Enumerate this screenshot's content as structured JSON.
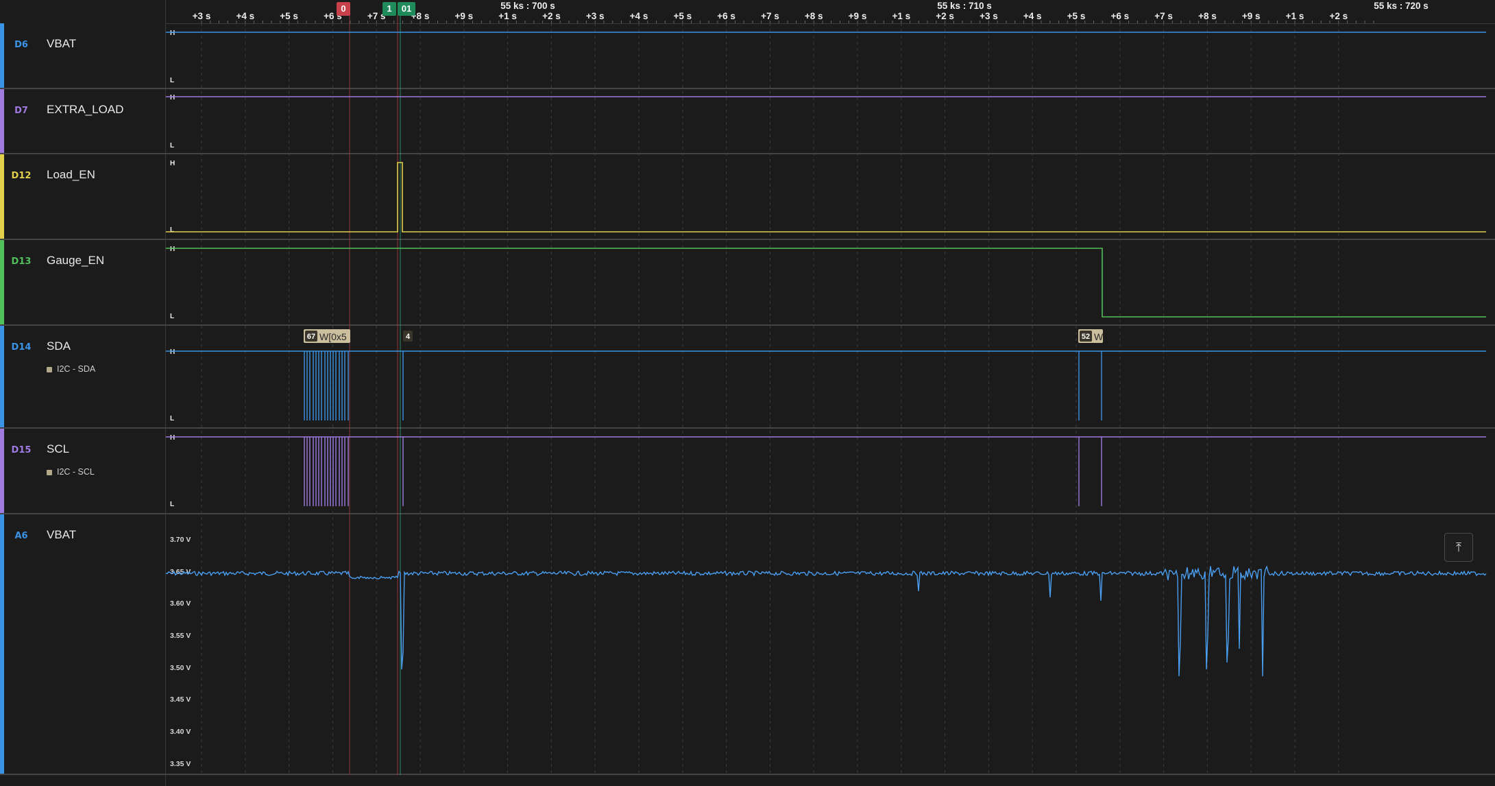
{
  "timeline": {
    "major_labels": [
      {
        "text": "55 ks : 700 s"
      },
      {
        "text": "55 ks : 710 s"
      },
      {
        "text": "55 ks : 720 s"
      }
    ],
    "ticks": [
      "+3 s",
      "+4 s",
      "+5 s",
      "+6 s",
      "+7 s",
      "+8 s",
      "+9 s",
      "+1 s",
      "+2 s",
      "+3 s",
      "+4 s",
      "+5 s",
      "+6 s",
      "+7 s",
      "+8 s",
      "+9 s",
      "+1 s",
      "+2 s",
      "+3 s",
      "+4 s",
      "+5 s",
      "+6 s",
      "+7 s",
      "+8 s",
      "+9 s",
      "+1 s",
      "+2 s"
    ],
    "markers": [
      {
        "label": "0",
        "color": "#c8404a"
      },
      {
        "label": "1",
        "color": "#1f8a5a"
      },
      {
        "label": "01",
        "color": "#1f8a5a"
      }
    ]
  },
  "channels": [
    {
      "id": "D6",
      "name": "VBAT",
      "color": "#3b93e6"
    },
    {
      "id": "D7",
      "name": "EXTRA_LOAD",
      "color": "#9f7be0"
    },
    {
      "id": "D12",
      "name": "Load_EN",
      "color": "#e2d04c"
    },
    {
      "id": "D13",
      "name": "Gauge_EN",
      "color": "#52c05a"
    },
    {
      "id": "D14",
      "name": "SDA",
      "color": "#3b93e6",
      "analyzer": "I2C - SDA"
    },
    {
      "id": "D15",
      "name": "SCL",
      "color": "#9f7be0",
      "analyzer": "I2C - SCL"
    },
    {
      "id": "A6",
      "name": "VBAT",
      "color": "#3b93e6"
    }
  ],
  "levels": {
    "high": "H",
    "low": "L"
  },
  "i2c_decodes": [
    {
      "badge": "67",
      "text": "W[0x5"
    },
    {
      "badge": "4",
      "text": ""
    },
    {
      "badge": "52",
      "text": "W"
    }
  ],
  "analog_axis": {
    "labels": [
      "3.70 V",
      "3.65 V",
      "3.60 V",
      "3.55 V",
      "3.50 V",
      "3.45 V",
      "3.40 V",
      "3.35 V"
    ]
  },
  "icons": {
    "autoscale": "vertical-fit-icon"
  }
}
